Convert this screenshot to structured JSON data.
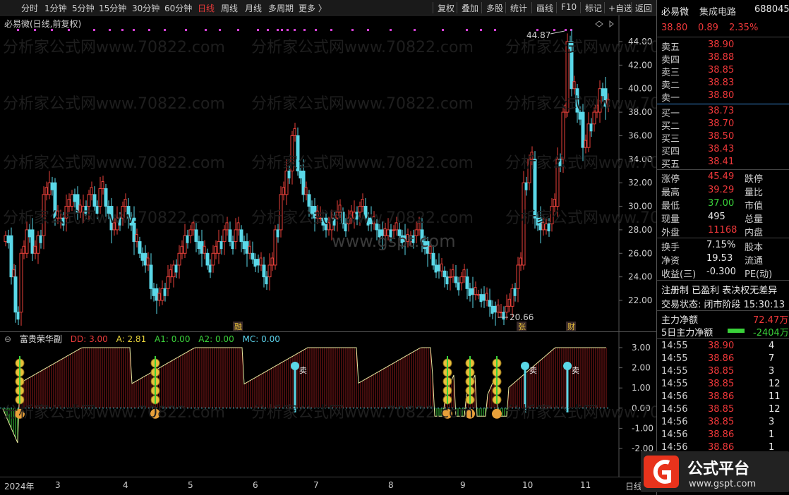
{
  "toolbar": {
    "left": [
      "分时",
      "1分钟",
      "5分钟",
      "15分钟",
      "30分钟",
      "60分钟",
      "日线",
      "周线",
      "月线",
      "多周期",
      "更多 〉"
    ],
    "active": "日线",
    "right": [
      "复权",
      "叠加",
      "多股",
      "统计",
      "画线",
      "F10",
      "标记",
      "+自选",
      "返回"
    ]
  },
  "main_chart": {
    "title": "必易微(日线,前复权)",
    "watermark": "分析家公式网www.70822.com",
    "watermark2": "www.gspt.com",
    "high_label": "44.87",
    "low_label": "20.66",
    "event_labels": [
      "融",
      "张",
      "财"
    ],
    "y_ticks": [
      "44.00",
      "42.00",
      "40.00",
      "38.00",
      "36.00",
      "34.00",
      "32.00",
      "30.00",
      "28.00",
      "26.00",
      "24.00",
      "22.00"
    ]
  },
  "indicator": {
    "name": "富贵荣华副",
    "dd": "DD: 3.00",
    "a": "A: 2.81",
    "a1": "A1: 0.00",
    "a2": "A2: 0.00",
    "mc": "MC: 0.00",
    "y_ticks": [
      "3.00",
      "2.00",
      "1.00",
      "0.00",
      "-1.00",
      "-2.00"
    ],
    "sell_label": "卖"
  },
  "x_axis": {
    "labels": [
      "2024年",
      "3",
      "4",
      "5",
      "6",
      "7",
      "8",
      "9",
      "10",
      "11"
    ],
    "right": "日线"
  },
  "quote": {
    "name": "必易微",
    "sector": "集成电路",
    "code": "688045",
    "price": "38.80",
    "change": "0.89",
    "change_pct": "2.35%",
    "sells": [
      [
        "卖五",
        "38.90"
      ],
      [
        "卖四",
        "38.88"
      ],
      [
        "卖三",
        "38.85"
      ],
      [
        "卖二",
        "38.83"
      ],
      [
        "卖一",
        "38.80"
      ]
    ],
    "buys": [
      [
        "买一",
        "38.73"
      ],
      [
        "买二",
        "38.70"
      ],
      [
        "买三",
        "38.50"
      ],
      [
        "买四",
        "38.43"
      ],
      [
        "买五",
        "38.41"
      ]
    ],
    "stats": [
      [
        "涨停",
        "45.49",
        "跌停"
      ],
      [
        "最高",
        "39.29",
        "量比"
      ],
      [
        "最低",
        "37.00",
        "市值"
      ],
      [
        "现量",
        "495",
        "总量"
      ],
      [
        "外盘",
        "11168",
        "内盘"
      ]
    ],
    "stats2": [
      [
        "换手",
        "7.15%",
        "股本"
      ],
      [
        "净资",
        "19.53",
        "流通"
      ],
      [
        "收益(三)",
        "-0.300",
        "PE(动)"
      ]
    ],
    "info": "注册制 已盈利 表决权无差异",
    "trade_status": "交易状态: 闭市阶段 15:30:13",
    "main_flow_label": "主力净额",
    "main_flow_value": "72.47万",
    "flow5_label": "5日主力净额",
    "flow5_value": "-2404万",
    "ticks": [
      [
        "14:55",
        "38.90",
        "4"
      ],
      [
        "14:55",
        "38.86",
        "7"
      ],
      [
        "14:55",
        "38.85",
        "3"
      ],
      [
        "14:55",
        "38.85",
        "12"
      ],
      [
        "14:56",
        "38.86",
        "11"
      ],
      [
        "14:56",
        "38.85",
        "12"
      ],
      [
        "14:56",
        "38.85",
        "3"
      ],
      [
        "14:56",
        "38.86",
        "1"
      ],
      [
        "14:56",
        "38.86",
        "1"
      ]
    ]
  },
  "logo": {
    "text": "公式平台",
    "url": "www.gspt.com"
  }
}
